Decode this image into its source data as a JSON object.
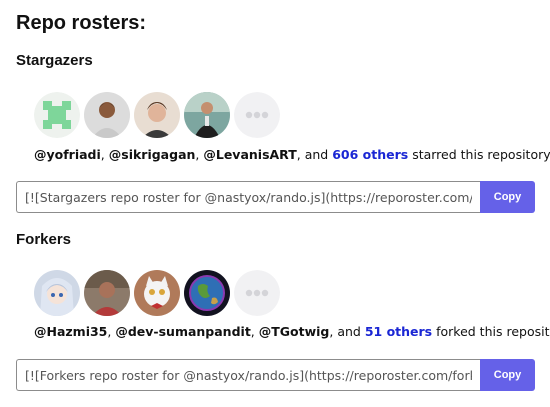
{
  "page": {
    "title": "Repo rosters:"
  },
  "stargazers": {
    "title": "Stargazers",
    "avatars": [
      {
        "icon": "identicon-avatar"
      },
      {
        "icon": "person-avatar"
      },
      {
        "icon": "person-avatar"
      },
      {
        "icon": "person-avatar"
      },
      {
        "icon": "more-placeholder-avatar"
      }
    ],
    "users": [
      "@yofriadi",
      "@sikrigagan",
      "@LevanisART"
    ],
    "sep1": ", ",
    "sep2": ", ",
    "sep3": ", and ",
    "others_link": "606 others",
    "suffix": " starred this repository.",
    "embed_value": "[![Stargazers repo roster for @nastyox/rando.js](https://reporoster.com/stars/nastyox/rando.js)](https://github.com/nastyox/rando.js/stargazers)",
    "copy_label": "Copy"
  },
  "forkers": {
    "title": "Forkers",
    "avatars": [
      {
        "icon": "anime-avatar"
      },
      {
        "icon": "person-avatar"
      },
      {
        "icon": "cat-avatar"
      },
      {
        "icon": "globe-avatar"
      },
      {
        "icon": "more-placeholder-avatar"
      }
    ],
    "users": [
      "@Hazmi35",
      "@dev-sumanpandit",
      "@TGotwig"
    ],
    "sep1": ", ",
    "sep2": ", ",
    "sep3": ", and ",
    "others_link": "51 others",
    "suffix": " forked this repository.",
    "embed_value": "[![Forkers repo roster for @nastyox/rando.js](https://reporoster.com/forks/nastyox/rando.js)](https://github.com/nastyox/rando.js/network/members)",
    "copy_label": "Copy"
  },
  "colors": {
    "accent": "#6561e8",
    "link": "#1a26d4"
  }
}
